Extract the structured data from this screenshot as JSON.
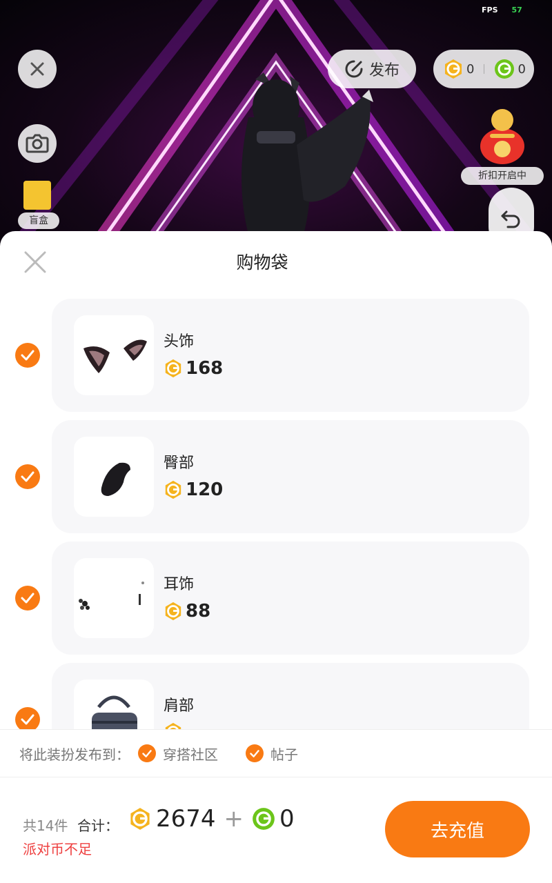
{
  "hud": {
    "fps_label": "FPS",
    "fps_value": "57"
  },
  "top_bar": {
    "publish_label": "发布",
    "gold_balance": "0",
    "green_balance": "0"
  },
  "side": {
    "blindbox_label": "盲盒",
    "promo_label": "折扣开启中"
  },
  "sheet": {
    "title": "购物袋",
    "items": [
      {
        "name": "头饰",
        "price": "168",
        "checked": true
      },
      {
        "name": "臀部",
        "price": "120",
        "checked": true
      },
      {
        "name": "耳饰",
        "price": "88",
        "checked": true
      },
      {
        "name": "肩部",
        "price": "",
        "checked": true
      }
    ],
    "publish_to": {
      "label": "将此装扮发布到：",
      "options": [
        {
          "label": "穿搭社区",
          "checked": true
        },
        {
          "label": "帖子",
          "checked": true
        }
      ]
    },
    "footer": {
      "count": "共14件",
      "total_label": "合计：",
      "gold_total": "2674",
      "plus": "+",
      "green_total": "0",
      "warning": "派对币不足",
      "recharge_label": "去充值"
    }
  },
  "colors": {
    "accent": "#f97a13",
    "warning": "#ee3f3f",
    "card_bg": "#f7f7f9",
    "gold_coin": "#f5b31e",
    "green_coin": "#6cc51a"
  }
}
